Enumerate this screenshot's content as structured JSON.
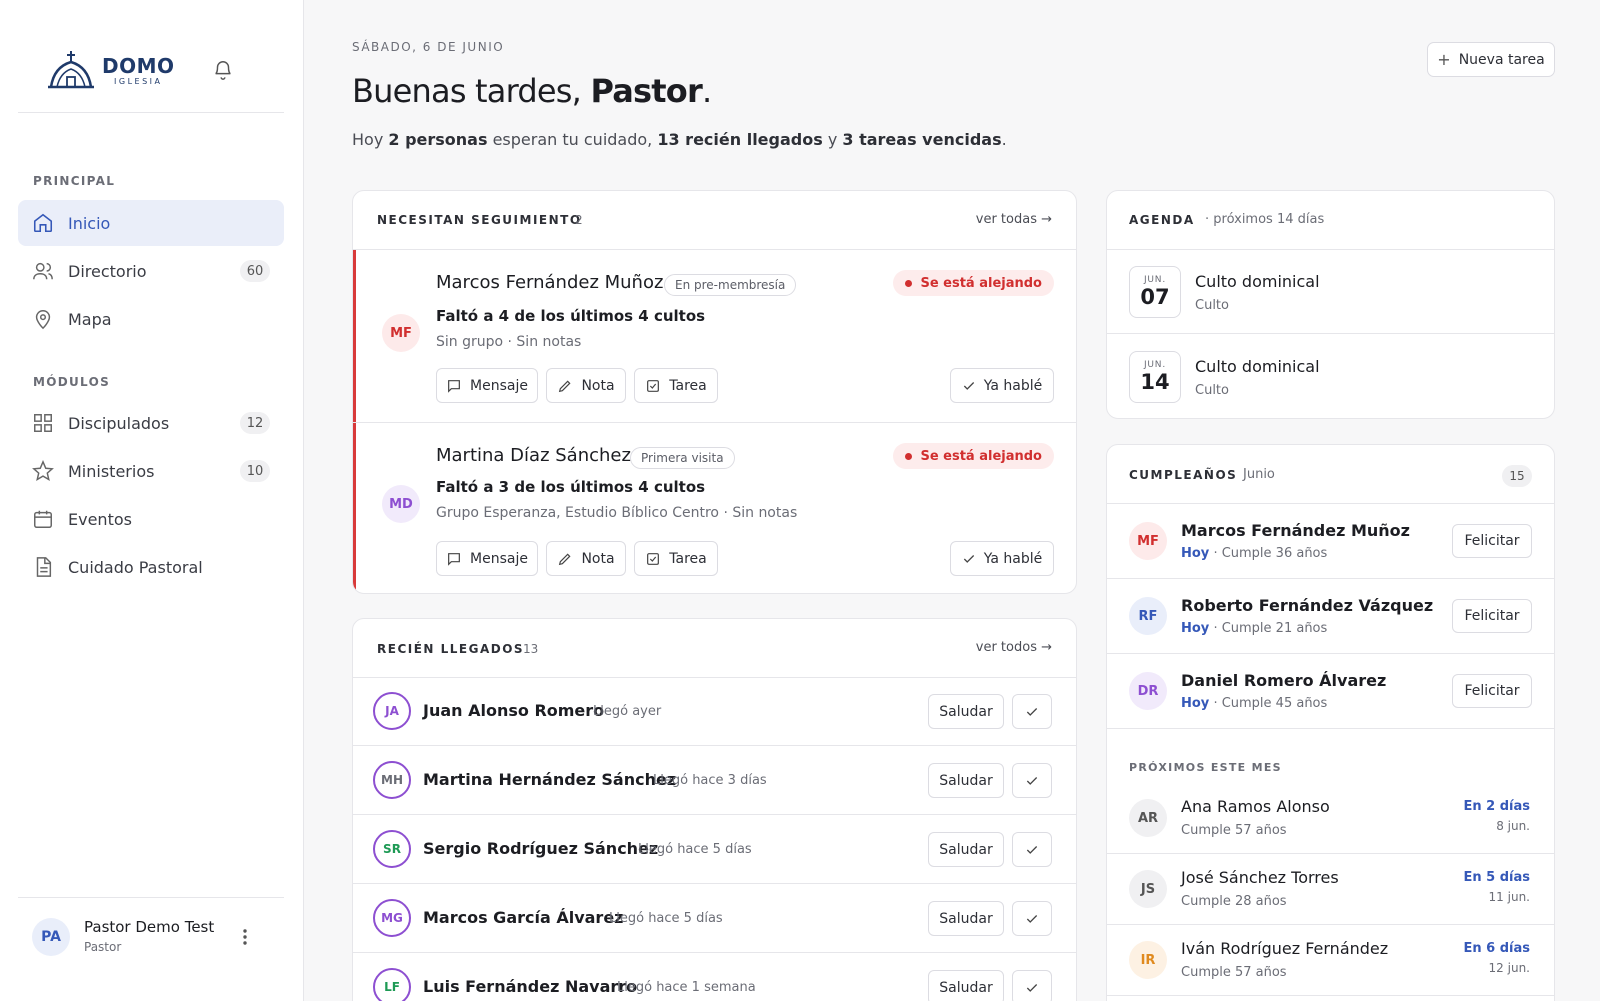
{
  "sidebar": {
    "logo": {
      "main": "DOMO",
      "sub": "IGLESIA"
    },
    "sections": {
      "principal": "PRINCIPAL",
      "modulos": "MÓDULOS"
    },
    "items": [
      {
        "label": "Inicio",
        "icon": "home-icon"
      },
      {
        "label": "Directorio",
        "icon": "users-icon",
        "count": "60"
      },
      {
        "label": "Mapa",
        "icon": "map-pin-icon"
      },
      {
        "label": "Discipulados",
        "icon": "grid-icon",
        "count": "12"
      },
      {
        "label": "Ministerios",
        "icon": "star-icon",
        "count": "10"
      },
      {
        "label": "Eventos",
        "icon": "calendar-icon"
      },
      {
        "label": "Cuidado Pastoral",
        "icon": "document-icon"
      }
    ],
    "user": {
      "initials": "PA",
      "name": "Pastor Demo Test",
      "role": "Pastor"
    }
  },
  "header": {
    "date": "SÁBADO, 6 DE JUNIO",
    "greeting_prefix": "Buenas tardes, ",
    "greeting_name": "Pastor",
    "greeting_suffix": ".",
    "summary": {
      "p1": "Hoy ",
      "b1": "2 personas",
      "p2": " esperan tu cuidado, ",
      "b2": "13 recién llegados",
      "p3": " y ",
      "b3": "3 tareas vencidas",
      "p4": "."
    },
    "new_task": "Nueva tarea"
  },
  "followup": {
    "title": "NECESITAN SEGUIMIENTO",
    "count": "2",
    "see_all": "ver todas →",
    "rows": [
      {
        "initials": "MF",
        "name": "Marcos Fernández Muñoz",
        "tag": "En pre-membresía",
        "alert": "Se está alejando",
        "missed": "Faltó a 4 de los últimos 4 cultos",
        "meta": "Sin grupo · Sin notas"
      },
      {
        "initials": "MD",
        "name": "Martina Díaz Sánchez",
        "tag": "Primera visita",
        "alert": "Se está alejando",
        "missed": "Faltó a 3 de los últimos 4 cultos",
        "meta": "Grupo Esperanza, Estudio Bíblico Centro · Sin notas"
      }
    ],
    "actions": {
      "message": "Mensaje",
      "note": "Nota",
      "task": "Tarea",
      "talked": "Ya hablé"
    }
  },
  "newcomers": {
    "title": "RECIÉN LLEGADOS",
    "count": "13",
    "see_all": "ver todos →",
    "greet_label": "Saludar",
    "rows": [
      {
        "initials": "JA",
        "name": "Juan Alonso Romero",
        "when": "Llegó ayer"
      },
      {
        "initials": "MH",
        "name": "Martina Hernández Sánchez",
        "when": "Llegó hace 3 días"
      },
      {
        "initials": "SR",
        "name": "Sergio Rodríguez Sánchez",
        "when": "Llegó hace 5 días"
      },
      {
        "initials": "MG",
        "name": "Marcos García Álvarez",
        "when": "Llegó hace 5 días"
      },
      {
        "initials": "LF",
        "name": "Luis Fernández Navarro",
        "when": "Llegó hace 1 semana"
      }
    ]
  },
  "agenda": {
    "title": "AGENDA",
    "subtitle": "· próximos 14 días",
    "events": [
      {
        "month": "JUN.",
        "day": "07",
        "title": "Culto dominical",
        "type": "Culto"
      },
      {
        "month": "JUN.",
        "day": "14",
        "title": "Culto dominical",
        "type": "Culto"
      }
    ]
  },
  "birthdays": {
    "title": "CUMPLEAÑOS",
    "month": "Junio",
    "count": "15",
    "congrats_label": "Felicitar",
    "today_label": "Hoy",
    "today": [
      {
        "initials": "MF",
        "name": "Marcos Fernández Muñoz",
        "age": "· Cumple 36 años"
      },
      {
        "initials": "RF",
        "name": "Roberto Fernández Vázquez",
        "age": "· Cumple 21 años"
      },
      {
        "initials": "DR",
        "name": "Daniel Romero Álvarez",
        "age": "· Cumple 45 años"
      }
    ],
    "upcoming_title": "PRÓXIMOS ESTE MES",
    "upcoming": [
      {
        "initials": "AR",
        "name": "Ana Ramos Alonso",
        "age": "Cumple 57 años",
        "in": "En 2 días",
        "date": "8 jun."
      },
      {
        "initials": "JS",
        "name": "José Sánchez Torres",
        "age": "Cumple 28 años",
        "in": "En 5 días",
        "date": "11 jun."
      },
      {
        "initials": "IR",
        "name": "Iván Rodríguez Fernández",
        "age": "Cumple 57 años",
        "in": "En 6 días",
        "date": "12 jun."
      }
    ]
  }
}
